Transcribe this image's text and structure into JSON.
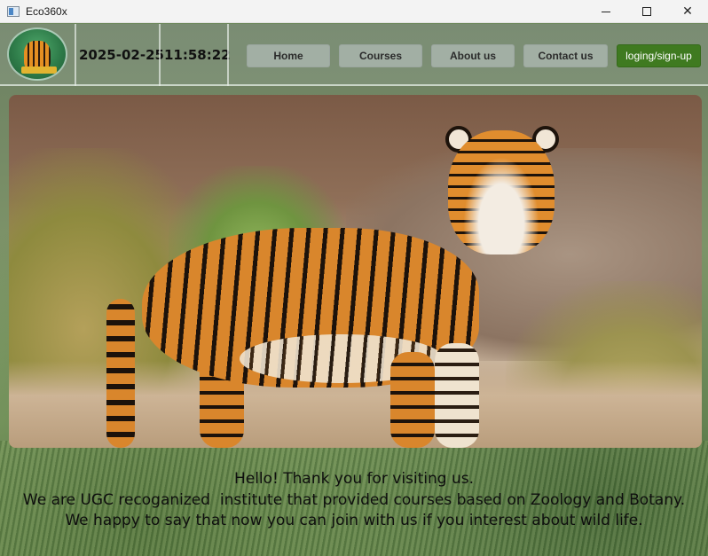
{
  "window": {
    "title": "Eco360x",
    "controls": {
      "minimize": "",
      "maximize": "",
      "close": "✕"
    }
  },
  "header": {
    "date": "2025-02-25",
    "time": "11:58:22",
    "nav": [
      {
        "label": "Home"
      },
      {
        "label": "Courses"
      },
      {
        "label": "About us"
      },
      {
        "label": "Contact us"
      }
    ],
    "login_label": "loging/sign-up"
  },
  "hero": {
    "icon": "tiger-photo"
  },
  "message": {
    "line1": "Hello! Thank you for visiting us.",
    "line2": "We are UGC recoganized  institute that provided courses based on Zoology and Botany.",
    "line3": "We happy to say that now you can join with us if you interest about wild life."
  },
  "colors": {
    "login_button": "#3f7a20",
    "nav_button": "#afb9b4",
    "titlebar": "#f3f3f3"
  }
}
